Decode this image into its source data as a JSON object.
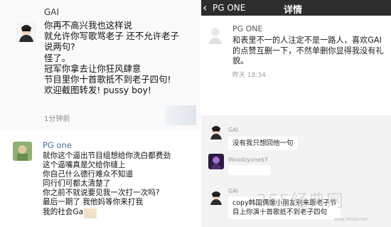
{
  "panel1": {
    "name": "GAI",
    "lines": "你再不高兴我也这样说\n就允许你写歌骂老子 还不允许老子\n说两句?\n怪了。\n冠军你拿去让你狂风肆意\n节目里你十首歌抵不到老子四句!\n欢迎截图转发! pussy boy!",
    "time": "1分钟前"
  },
  "panel2": {
    "back_label": "‹",
    "title": "PG ONE",
    "center_title": "详情",
    "name": "PG ONE",
    "text": "和表里不一的人注定不是一路人，喜欢GAI\n的点赞互删一下，不然单删你显得我没有礼\n貌。",
    "time": "昨天 18:34"
  },
  "panel3": {
    "name": "PG one",
    "lines": "就你这个逼出节目组想给你洗白都费劲\n这个逼嘴真是欠给你缝上\n你自己什么德行难众不知道\n同行们可都太清楚了\n你之前不就说要见我一次打一次吗?\n最后一期了 我他妈等你来打我\n我的社会Gai"
  },
  "panel4": {
    "messages": [
      {
        "name": "GAI",
        "text": "没有我只想回他一句"
      },
      {
        "name": "Woodzyone$Y",
        "text": ""
      },
      {
        "name": "GAI",
        "text": "copy韩国偶像小朋友别来跟老子节\n目上你演十首歌抵不到老子四句"
      }
    ]
  },
  "watermark": "365经典网",
  "watermark_url": "www.365jd.com",
  "colors": {
    "topbar": "#2d2d2d",
    "pg_name": "#4a6fa5",
    "highlight": "#f1e2c7"
  }
}
